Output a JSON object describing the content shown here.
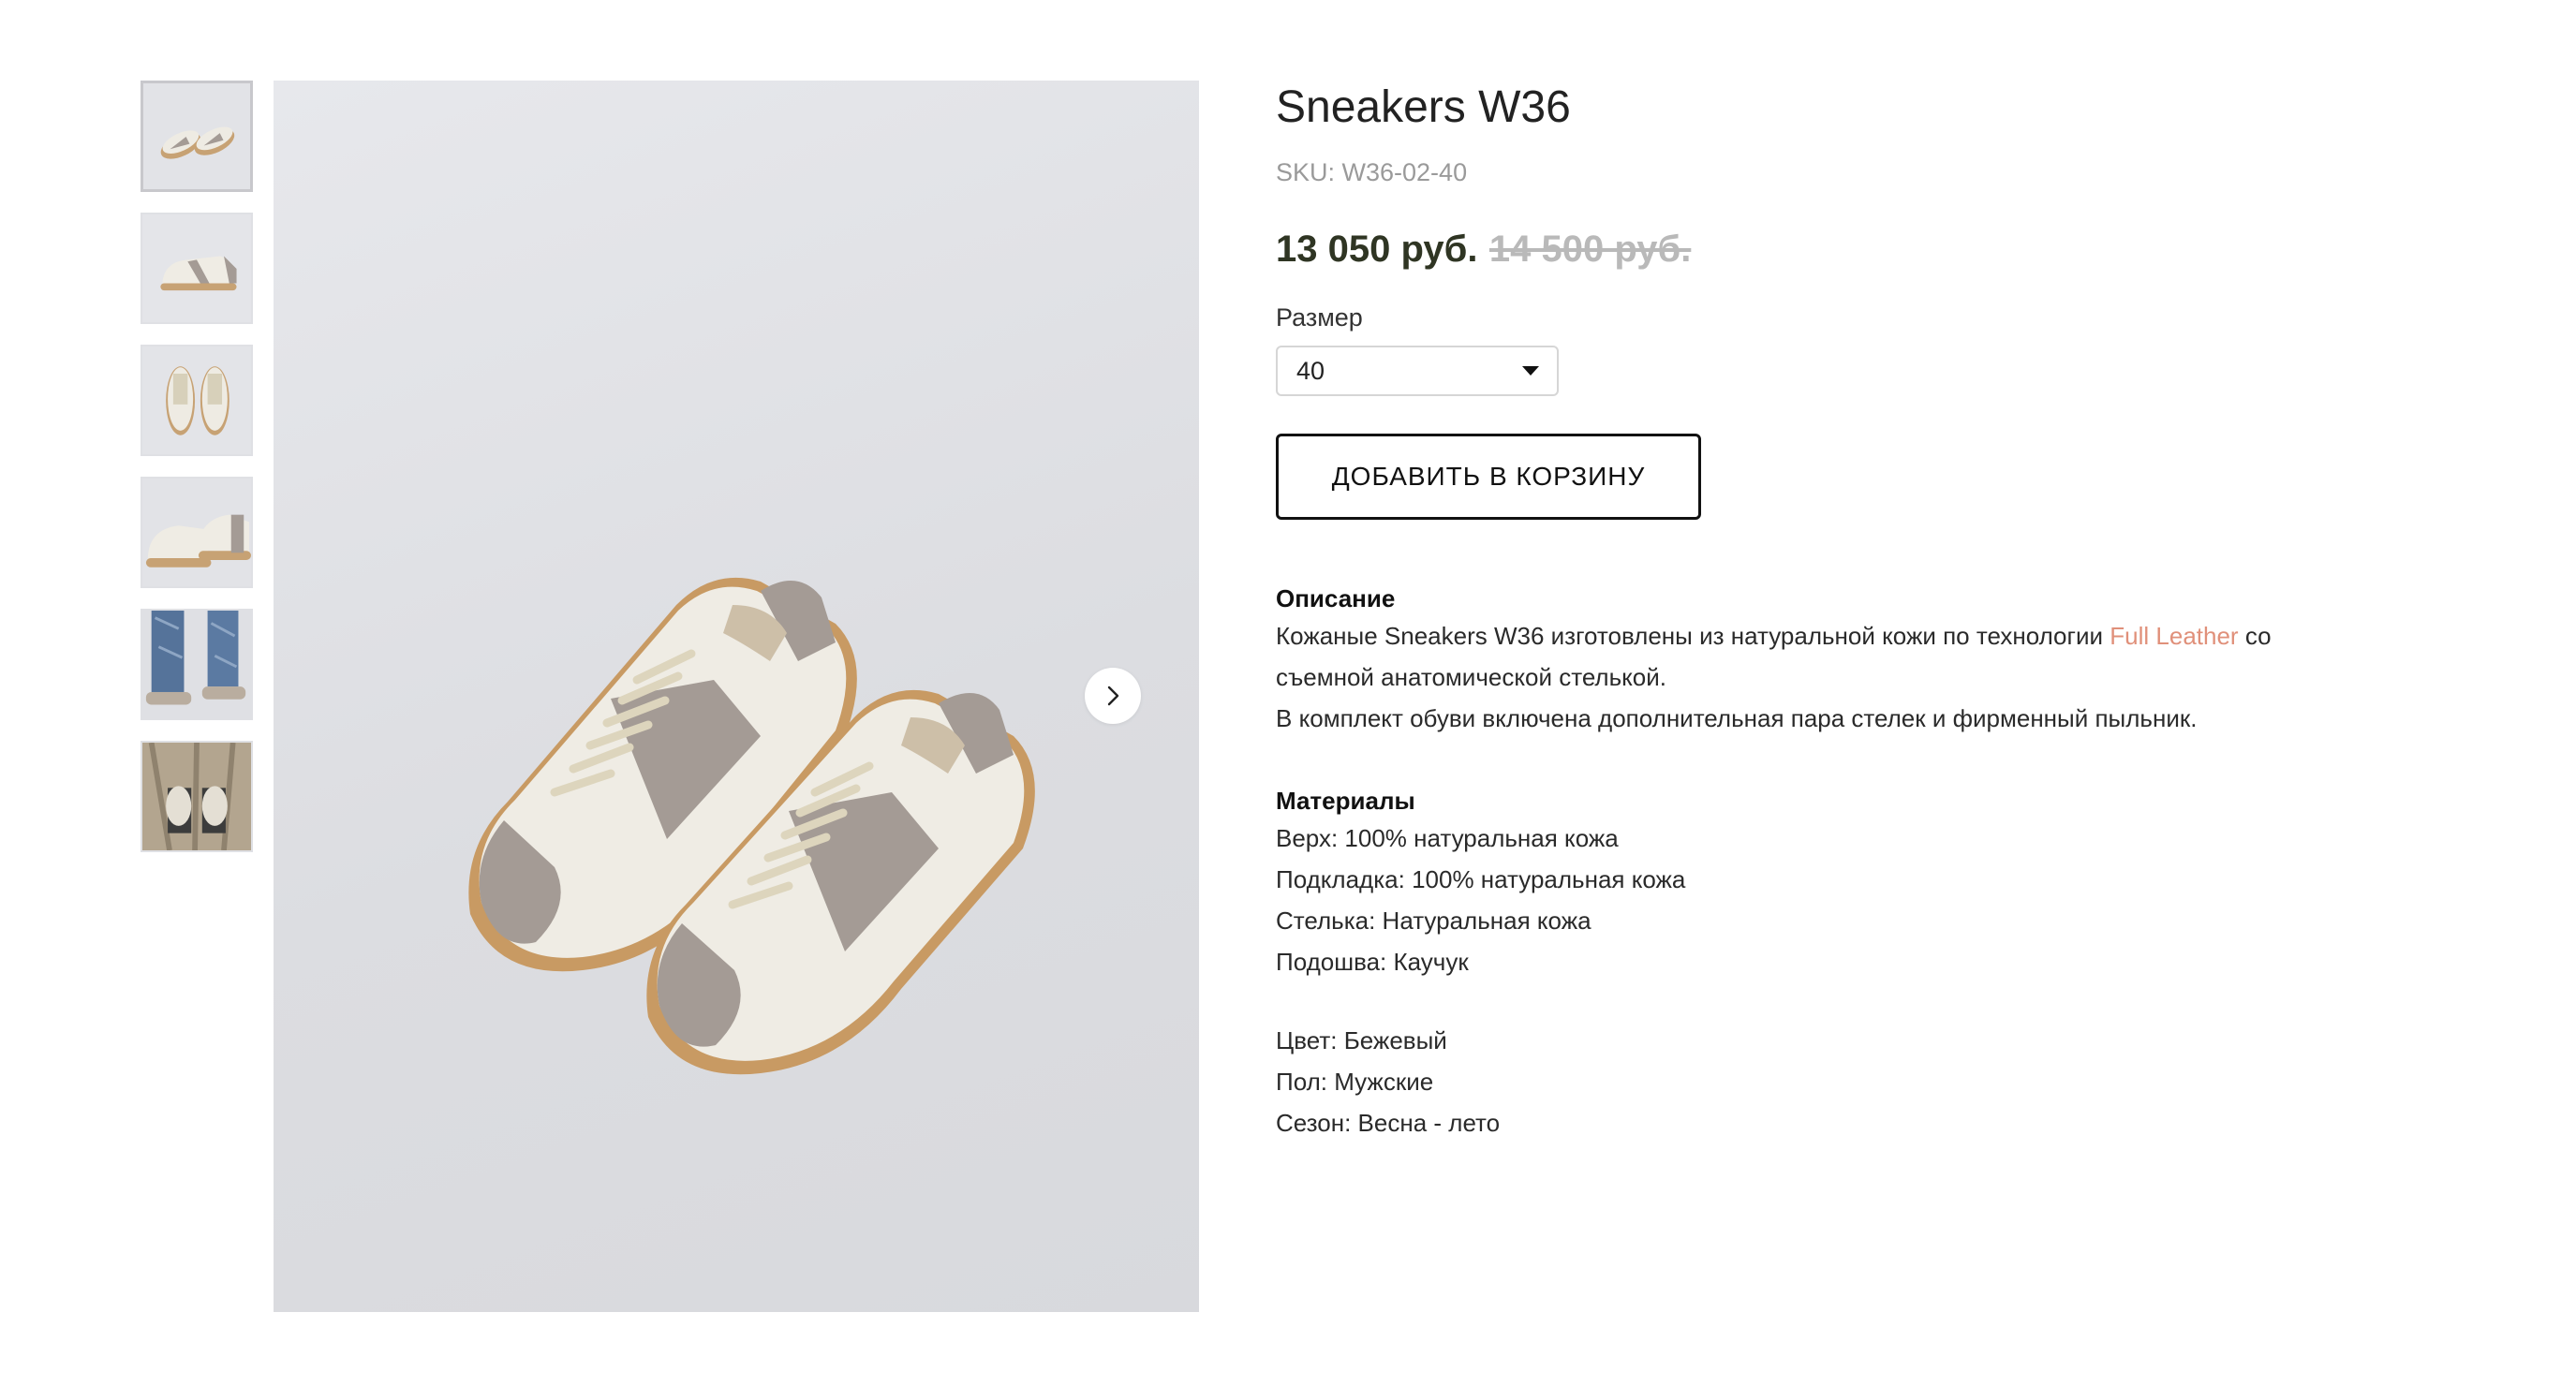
{
  "product": {
    "title": "Sneakers W36",
    "sku": "SKU: W36-02-40",
    "price": "13 050 руб.",
    "old_price": "14 500 руб.",
    "size_label": "Размер",
    "size_selected": "40",
    "add_to_cart": "ДОБАВИТЬ В КОРЗИНУ"
  },
  "description": {
    "title": "Описание",
    "line1_before": "Кожаные Sneakers W36 изготовлены из натуральной кожи по технологии ",
    "link": "Full Leather",
    "line1_after": " со",
    "line2": "съемной анатомической стелькой.",
    "line3": "В комплект обуви включена дополнительная пара стелек и фирменный пыльник."
  },
  "materials": {
    "title": "Материалы",
    "items": [
      "Верх: 100% натуральная кожа",
      "Подкладка: 100% натуральная кожа",
      "Стелька: Натуральная кожа",
      "Подошва: Каучук"
    ]
  },
  "attributes": [
    "Цвет: Бежевый",
    "Пол: Мужские",
    "Сезон: Весна - лето"
  ],
  "gallery": {
    "thumbnails": [
      "photo-sneakers-pair-top",
      "photo-sneaker-side",
      "photo-sneakers-front",
      "photo-sneakers-heel",
      "photo-sneakers-worn-jeans",
      "photo-sneakers-worn-coat"
    ],
    "active_index": 0,
    "next_icon": "chevron-right-icon"
  },
  "colors": {
    "price": "#2f3523",
    "old_price": "#b9b9b9",
    "link": "#e0907a",
    "suede": "#a49b95",
    "leather": "#efece4",
    "sole": "#c89a63",
    "laces": "#ddd5bd"
  }
}
